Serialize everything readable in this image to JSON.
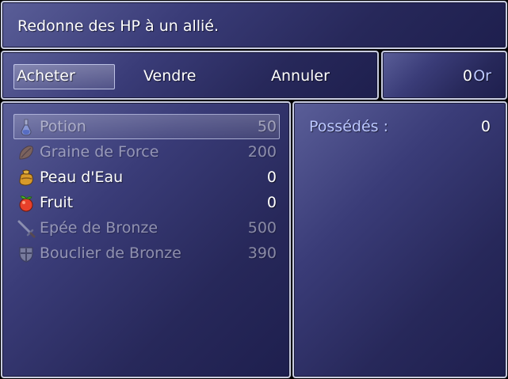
{
  "help": {
    "text": "Redonne des HP à un allié."
  },
  "commands": {
    "buy": "Acheter",
    "sell": "Vendre",
    "cancel": "Annuler"
  },
  "gold": {
    "value": "0",
    "unit": "Or"
  },
  "items": [
    {
      "name": "Potion",
      "price": "50",
      "icon": "potion-icon",
      "enabled": false
    },
    {
      "name": "Graine de Force",
      "price": "200",
      "icon": "seed-icon",
      "enabled": false
    },
    {
      "name": "Peau d'Eau",
      "price": "0",
      "icon": "water-skin-icon",
      "enabled": true
    },
    {
      "name": "Fruit",
      "price": "0",
      "icon": "fruit-icon",
      "enabled": true
    },
    {
      "name": "Epée de Bronze",
      "price": "500",
      "icon": "sword-icon",
      "enabled": false
    },
    {
      "name": "Bouclier de Bronze",
      "price": "390",
      "icon": "shield-icon",
      "enabled": false
    }
  ],
  "status": {
    "owned_label": "Possédés :",
    "owned_value": "0"
  },
  "colors": {
    "window_top": "#5a5e98",
    "window_bottom": "#1e1f4e",
    "system_text": "#bcc8ff"
  }
}
